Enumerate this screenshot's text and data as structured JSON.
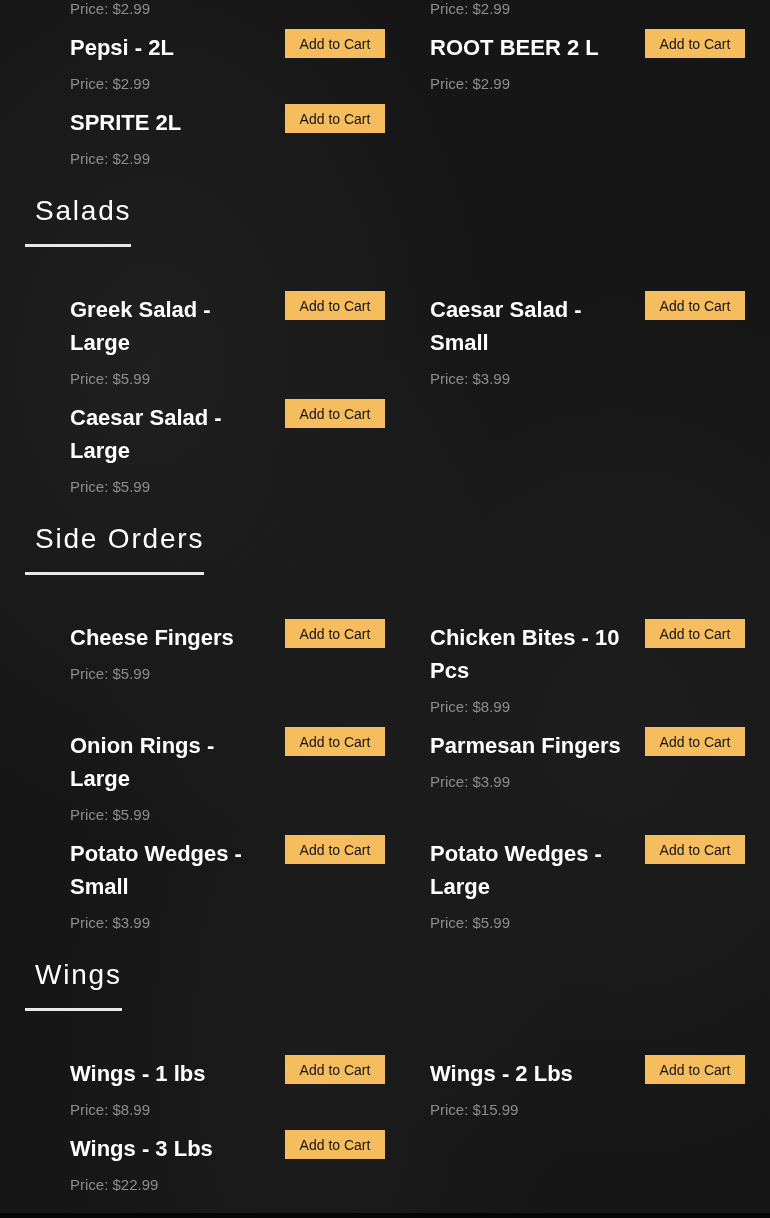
{
  "sections": [
    {
      "items": [
        {
          "price": "Price: $2.99"
        },
        {
          "price": "Price: $2.99"
        },
        {
          "name": "Pepsi - 2L",
          "price": "Price: $2.99",
          "button": "Add to Cart"
        },
        {
          "name": "ROOT BEER 2 L",
          "price": "Price: $2.99",
          "button": "Add to Cart"
        },
        {
          "name": "SPRITE 2L",
          "price": "Price: $2.99",
          "button": "Add to Cart"
        }
      ]
    },
    {
      "heading": "Salads",
      "items": [
        {
          "name": "Greek Salad - Large",
          "price": "Price: $5.99",
          "button": "Add to Cart"
        },
        {
          "name": "Caesar Salad - Small",
          "price": "Price: $3.99",
          "button": "Add to Cart"
        },
        {
          "name": "Caesar Salad - Large",
          "price": "Price: $5.99",
          "button": "Add to Cart"
        }
      ]
    },
    {
      "heading": "Side Orders",
      "items": [
        {
          "name": "Cheese Fingers",
          "price": "Price: $5.99",
          "button": "Add to Cart"
        },
        {
          "name": "Chicken Bites - 10 Pcs",
          "price": "Price: $8.99",
          "button": "Add to Cart"
        },
        {
          "name": "Onion Rings - Large",
          "price": "Price: $5.99",
          "button": "Add to Cart"
        },
        {
          "name": "Parmesan Fingers",
          "price": "Price: $3.99",
          "button": "Add to Cart"
        },
        {
          "name": "Potato Wedges - Small",
          "price": "Price: $3.99",
          "button": "Add to Cart"
        },
        {
          "name": "Potato Wedges - Large",
          "price": "Price: $5.99",
          "button": "Add to Cart"
        }
      ]
    },
    {
      "heading": "Wings",
      "items": [
        {
          "name": "Wings - 1 lbs",
          "price": "Price: $8.99",
          "button": "Add to Cart"
        },
        {
          "name": "Wings - 2 Lbs",
          "price": "Price: $15.99",
          "button": "Add to Cart"
        },
        {
          "name": "Wings - 3 Lbs",
          "price": "Price: $22.99",
          "button": "Add to Cart"
        }
      ]
    }
  ]
}
